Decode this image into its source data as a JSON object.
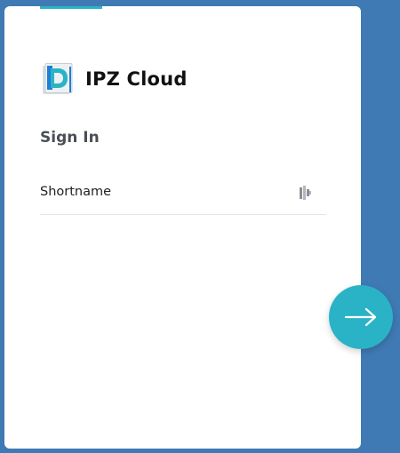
{
  "brand": {
    "name": "IPZ Cloud",
    "logo_icon": "ipz-cloud-logo"
  },
  "signin": {
    "title": "Sign In",
    "shortname_placeholder": "Shortname",
    "shortname_value": "",
    "field_icon": "key-dots-icon",
    "next_icon": "arrow-right-icon"
  },
  "colors": {
    "background": "#3f7ab4",
    "card": "#ffffff",
    "accent": "#2ab3c6"
  }
}
